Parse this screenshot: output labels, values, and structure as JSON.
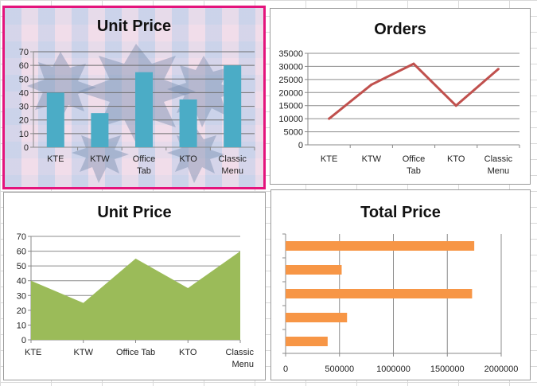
{
  "charts": {
    "unit_price_bar": {
      "title": "Unit Price",
      "colors": {
        "bar": "#4bacc6"
      }
    },
    "orders_line": {
      "title": "Orders",
      "colors": {
        "line": "#c0504d"
      }
    },
    "unit_price_area": {
      "title": "Unit Price",
      "colors": {
        "area": "#9bbb59"
      }
    },
    "total_price_bar": {
      "title": "Total Price",
      "colors": {
        "bar": "#f79646"
      }
    }
  },
  "chart_data": [
    {
      "type": "bar",
      "title": "Unit Price",
      "categories": [
        "KTE",
        "KTW",
        "Office Tab",
        "KTO",
        "Classic Menu"
      ],
      "values": [
        40,
        25,
        55,
        35,
        60
      ],
      "ylim": [
        0,
        70
      ],
      "yticks": [
        0,
        10,
        20,
        30,
        40,
        50,
        60,
        70
      ],
      "grid": true
    },
    {
      "type": "line",
      "title": "Orders",
      "categories": [
        "KTE",
        "KTW",
        "Office Tab",
        "KTO",
        "Classic Menu"
      ],
      "values": [
        10000,
        23000,
        31000,
        15000,
        29000
      ],
      "ylim": [
        0,
        35000
      ],
      "yticks": [
        0,
        5000,
        10000,
        15000,
        20000,
        25000,
        30000,
        35000
      ],
      "grid": true
    },
    {
      "type": "area",
      "title": "Unit Price",
      "categories": [
        "KTE",
        "KTW",
        "Office Tab",
        "KTO",
        "Classic Menu"
      ],
      "values": [
        40,
        25,
        55,
        35,
        60
      ],
      "ylim": [
        0,
        70
      ],
      "yticks": [
        0,
        10,
        20,
        30,
        40,
        50,
        60,
        70
      ],
      "grid": true
    },
    {
      "type": "bar",
      "orientation": "horizontal",
      "title": "Total Price",
      "values": [
        1750000,
        520000,
        1730000,
        570000,
        390000
      ],
      "xlim": [
        0,
        2000000
      ],
      "xticks": [
        0,
        500000,
        1000000,
        1500000,
        2000000
      ],
      "grid": true
    }
  ]
}
